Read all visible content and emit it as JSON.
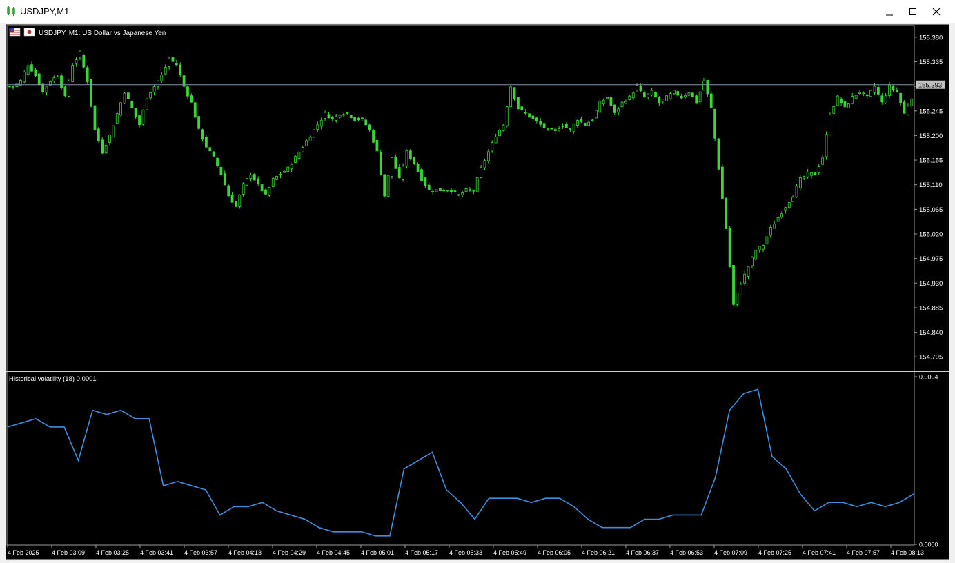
{
  "window": {
    "title": "USDJPY,M1"
  },
  "main_chart": {
    "label": "USDJPY, M1:  US Dollar vs Japanese Yen",
    "current_price": "155.293",
    "colors": {
      "candle": "#3cd636",
      "price_line": "#7f97b1",
      "background": "#000000"
    }
  },
  "indicator": {
    "label": "Historical volatility (18) 0.0001",
    "color": "#3a8fe0"
  },
  "chart_data": [
    {
      "type": "candlestick",
      "title": "USDJPY, M1:  US Dollar vs Japanese Yen",
      "y_ticks": [
        "155.380",
        "155.335",
        "155.290",
        "155.245",
        "155.200",
        "155.155",
        "155.110",
        "155.065",
        "155.020",
        "154.975",
        "154.930",
        "154.885",
        "154.840",
        "154.795"
      ],
      "ylim": [
        154.77,
        155.4
      ],
      "current_price": 155.293,
      "close": [
        155.29,
        155.3,
        155.33,
        155.31,
        155.28,
        155.3,
        155.31,
        155.27,
        155.33,
        155.35,
        155.3,
        155.21,
        155.17,
        155.2,
        155.24,
        155.28,
        155.25,
        155.22,
        155.27,
        155.29,
        155.31,
        155.34,
        155.33,
        155.29,
        155.26,
        155.21,
        155.18,
        155.16,
        155.13,
        155.09,
        155.07,
        155.11,
        155.13,
        155.11,
        155.09,
        155.12,
        155.13,
        155.14,
        155.16,
        155.18,
        155.2,
        155.22,
        155.24,
        155.23,
        155.24,
        155.24,
        155.23,
        155.23,
        155.21,
        155.17,
        155.09,
        155.16,
        155.12,
        155.17,
        155.15,
        155.12,
        155.1,
        155.1,
        155.1,
        155.1,
        155.09,
        155.1,
        155.1,
        155.14,
        155.17,
        155.2,
        155.22,
        155.29,
        155.25,
        155.24,
        155.23,
        155.22,
        155.21,
        155.21,
        155.22,
        155.21,
        155.23,
        155.22,
        155.23,
        155.26,
        155.27,
        155.24,
        155.26,
        155.27,
        155.29,
        155.27,
        155.28,
        155.26,
        155.27,
        155.28,
        155.27,
        155.28,
        155.26,
        155.3,
        155.25,
        155.14,
        155.03,
        154.89,
        154.93,
        154.96,
        154.99,
        155.0,
        155.03,
        155.05,
        155.07,
        155.09,
        155.12,
        155.13,
        155.13,
        155.16,
        155.24,
        155.27,
        155.25,
        155.27,
        155.28,
        155.27,
        155.29,
        155.26,
        155.29,
        155.28,
        155.24,
        155.27
      ],
      "series": [
        {
          "name": "",
          "values": []
        }
      ]
    },
    {
      "type": "line",
      "title": "Historical volatility (18) 0.0001",
      "y_ticks": [
        "0.0004",
        "0.0000"
      ],
      "ylim": [
        0,
        0.0004
      ],
      "x_ticks": [
        "4 Feb 2025",
        "4 Feb 03:09",
        "4 Feb 03:25",
        "4 Feb 03:41",
        "4 Feb 03:57",
        "4 Feb 04:13",
        "4 Feb 04:29",
        "4 Feb 04:45",
        "4 Feb 05:01",
        "4 Feb 05:17",
        "4 Feb 05:33",
        "4 Feb 05:49",
        "4 Feb 06:05",
        "4 Feb 06:21",
        "4 Feb 06:37",
        "4 Feb 06:53",
        "4 Feb 07:09",
        "4 Feb 07:25",
        "4 Feb 07:41",
        "4 Feb 07:57",
        "4 Feb 08:13"
      ],
      "values": [
        0.00028,
        0.00029,
        0.0003,
        0.00028,
        0.00028,
        0.0002,
        0.00032,
        0.00031,
        0.00032,
        0.0003,
        0.0003,
        0.00014,
        0.00015,
        0.00014,
        0.00013,
        7e-05,
        9e-05,
        9e-05,
        0.0001,
        8e-05,
        7e-05,
        6e-05,
        4e-05,
        3e-05,
        3e-05,
        3e-05,
        2e-05,
        2e-05,
        0.00018,
        0.0002,
        0.00022,
        0.00013,
        0.0001,
        6e-05,
        0.00011,
        0.00011,
        0.00011,
        0.0001,
        0.00011,
        0.00011,
        9e-05,
        6e-05,
        4e-05,
        4e-05,
        4e-05,
        6e-05,
        6e-05,
        7e-05,
        7e-05,
        7e-05,
        0.00016,
        0.00032,
        0.00036,
        0.00037,
        0.00021,
        0.00018,
        0.00012,
        8e-05,
        0.0001,
        0.0001,
        9e-05,
        0.0001,
        9e-05,
        0.0001,
        0.00012
      ]
    }
  ]
}
